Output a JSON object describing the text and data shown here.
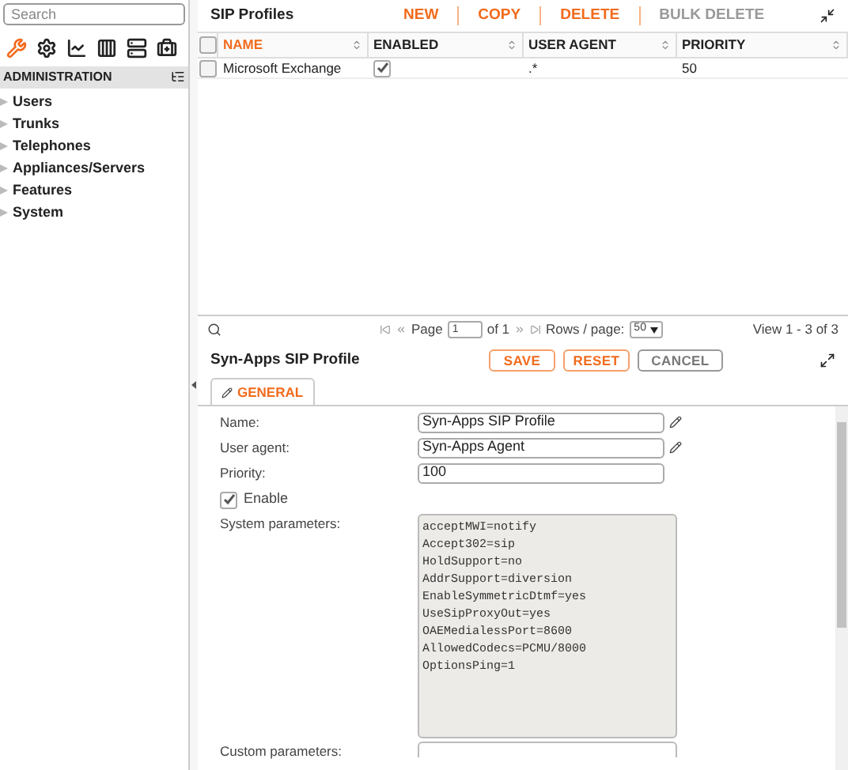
{
  "sidebar": {
    "search": {
      "placeholder": "Search"
    },
    "toolbar": [
      {
        "kind": "wrench",
        "selected": true
      },
      {
        "kind": "gear",
        "selected": false
      },
      {
        "kind": "chart",
        "selected": false
      },
      {
        "kind": "columns",
        "selected": false
      },
      {
        "kind": "device",
        "selected": false
      },
      {
        "kind": "kit",
        "selected": false
      }
    ],
    "section": "ADMINISTRATION",
    "items": [
      {
        "label": "Users",
        "expanded": false
      },
      {
        "label": "Trunks",
        "expanded": false
      },
      {
        "label": "Telephones",
        "expanded": false
      },
      {
        "label": "Appliances/Servers",
        "expanded": false
      },
      {
        "label": "Features",
        "expanded": false
      },
      {
        "label": "System",
        "expanded": false
      }
    ]
  },
  "list": {
    "title": "SIP Profiles",
    "actions": [
      {
        "label": "NEW",
        "disabled": false
      },
      {
        "label": "COPY",
        "disabled": false
      },
      {
        "label": "DELETE",
        "disabled": false
      },
      {
        "label": "BULK DELETE",
        "disabled": true
      }
    ],
    "all_selected": false,
    "columns": [
      {
        "label": "NAME",
        "sorted": true
      },
      {
        "label": "ENABLED",
        "sorted": false
      },
      {
        "label": "USER AGENT",
        "sorted": false
      },
      {
        "label": "PRIORITY",
        "sorted": false
      }
    ],
    "rows": [
      {
        "selected": false,
        "name": "Microsoft Exchange",
        "enabled": true,
        "user_agent": ".*",
        "priority": "50"
      }
    ],
    "pager": {
      "page_label": "Page",
      "page": "1",
      "of": "of 1",
      "rows_label": "Rows / page:",
      "rows": "50",
      "view": "View 1 - 3 of 3"
    }
  },
  "form": {
    "title": "Syn-Apps SIP Profile",
    "buttons": [
      {
        "label": "SAVE",
        "kind": "primary"
      },
      {
        "label": "RESET",
        "kind": "primary"
      },
      {
        "label": "CANCEL",
        "kind": "secondary"
      }
    ],
    "tabs": [
      {
        "label": "GENERAL",
        "selected": true
      }
    ],
    "fields": [
      {
        "label": "Name:",
        "value": "Syn-Apps SIP Profile",
        "editable": true
      },
      {
        "label": "User agent:",
        "value": "Syn-Apps Agent",
        "editable": true
      },
      {
        "label": "Priority:",
        "value": "100",
        "editable": false
      }
    ],
    "enable": {
      "label": "Enable",
      "checked": true
    },
    "system_parameters": {
      "label": "System parameters:",
      "lines": [
        "acceptMWI=notify",
        "Accept302=sip",
        "HoldSupport=no",
        "AddrSupport=diversion",
        "EnableSymmetricDtmf=yes",
        "UseSipProxyOut=yes",
        "OAEMedialessPort=8600",
        "AllowedCodecs=PCMU/8000",
        "OptionsPing=1"
      ]
    },
    "custom_parameters": {
      "label": "Custom parameters:"
    }
  }
}
